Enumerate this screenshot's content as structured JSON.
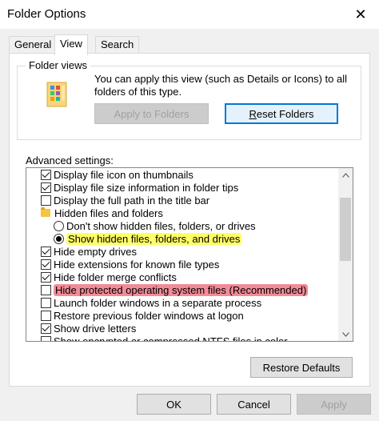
{
  "window": {
    "title": "Folder Options",
    "close_glyph": "✕"
  },
  "tabs": [
    {
      "label": "General"
    },
    {
      "label": "View",
      "active": true
    },
    {
      "label": "Search"
    }
  ],
  "folder_views": {
    "label": "Folder views",
    "description": "You can apply this view (such as Details or Icons) to all folders of this type.",
    "apply_button": "Apply to Folders",
    "reset_button": "Reset Folders",
    "reset_button_mnemonic": "R"
  },
  "advanced": {
    "label": "Advanced settings:",
    "items": [
      {
        "type": "checkbox",
        "checked": true,
        "label": "Display file icon on thumbnails"
      },
      {
        "type": "checkbox",
        "checked": true,
        "label": "Display file size information in folder tips"
      },
      {
        "type": "checkbox",
        "checked": false,
        "label": "Display the full path in the title bar"
      },
      {
        "type": "folder",
        "label": "Hidden files and folders"
      },
      {
        "type": "radio",
        "checked": false,
        "label": "Don't show hidden files, folders, or drives"
      },
      {
        "type": "radio",
        "checked": true,
        "label": "Show hidden files, folders, and drives",
        "highlight": "yellow"
      },
      {
        "type": "checkbox",
        "checked": true,
        "label": "Hide empty drives"
      },
      {
        "type": "checkbox",
        "checked": true,
        "label": "Hide extensions for known file types"
      },
      {
        "type": "checkbox",
        "checked": true,
        "label": "Hide folder merge conflicts"
      },
      {
        "type": "checkbox",
        "checked": false,
        "label": "Hide protected operating system files (Recommended)",
        "highlight": "red"
      },
      {
        "type": "checkbox",
        "checked": false,
        "label": "Launch folder windows in a separate process"
      },
      {
        "type": "checkbox",
        "checked": false,
        "label": "Restore previous folder windows at logon"
      },
      {
        "type": "checkbox",
        "checked": true,
        "label": "Show drive letters"
      },
      {
        "type": "checkbox",
        "checked": false,
        "label": "Show encrypted or compressed NTFS files in color"
      }
    ],
    "restore_defaults": "Restore Defaults"
  },
  "footer": {
    "ok": "OK",
    "cancel": "Cancel",
    "apply": "Apply"
  },
  "colors": {
    "highlight_yellow": "#ffff66",
    "highlight_red": "#f28b98",
    "focus_blue": "#0078d7"
  }
}
